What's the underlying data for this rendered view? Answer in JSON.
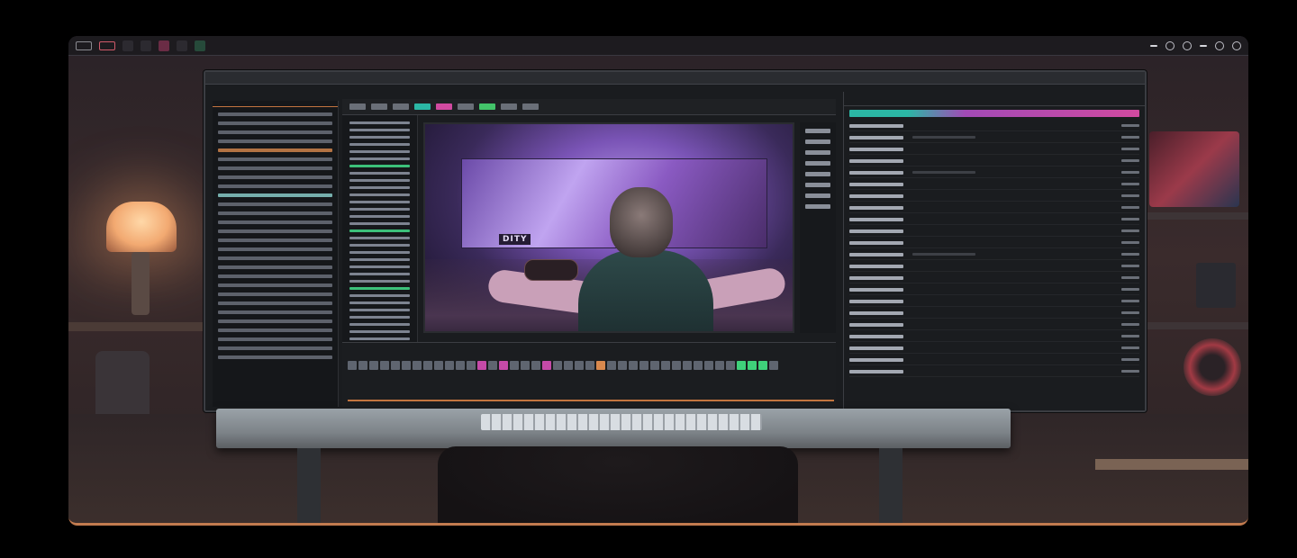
{
  "window": {
    "tabs": [
      "",
      "",
      "",
      ""
    ],
    "controls": [
      "close",
      "minimize",
      "maximize"
    ]
  },
  "preview": {
    "caption": "DITY"
  },
  "icons": {
    "window_close": "close-icon",
    "settings": "gear-icon",
    "search": "search-icon",
    "info": "info-icon",
    "help": "help-icon"
  },
  "colors": {
    "accent_orange": "#c27b4f",
    "accent_teal": "#2bb7a5",
    "accent_pink": "#d14aa0",
    "accent_green": "#43c46a"
  }
}
